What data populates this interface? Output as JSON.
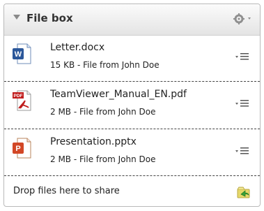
{
  "panel": {
    "title": "File box",
    "icons": {
      "collapse": "triangle-down-icon",
      "settings": "gear-icon"
    }
  },
  "files": [
    {
      "name": "Letter.docx",
      "meta": "15 KB - File from John Doe",
      "type_icon": "word-doc-icon",
      "icon_letter": "W",
      "accent": "#2b579a"
    },
    {
      "name": "TeamViewer_Manual_EN.pdf",
      "meta": "2 MB - File from John Doe",
      "type_icon": "pdf-icon",
      "icon_letter": "PDF",
      "accent": "#c01d1d"
    },
    {
      "name": "Presentation.pptx",
      "meta": "2 MB - File from John Doe",
      "type_icon": "powerpoint-icon",
      "icon_letter": "P",
      "accent": "#d24726"
    }
  ],
  "drop_zone": {
    "text": "Drop files here to share",
    "icon": "share-folder-icon"
  }
}
